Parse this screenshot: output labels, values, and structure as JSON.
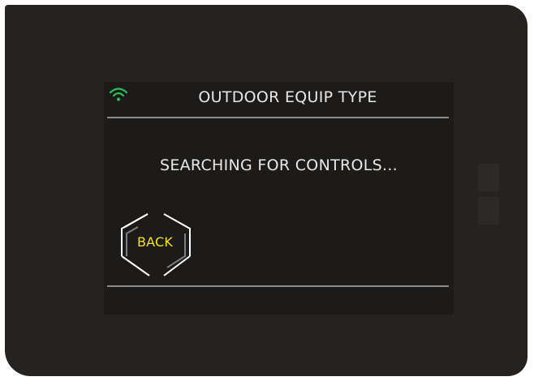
{
  "screen": {
    "title": "OUTDOOR EQUIP TYPE",
    "status_message": "SEARCHING FOR CONTROLS...",
    "wifi_icon": "wifi-icon",
    "wifi_color": "#2fbf5a"
  },
  "buttons": {
    "back_label": "BACK",
    "back_label_color": "#f2e51a"
  }
}
